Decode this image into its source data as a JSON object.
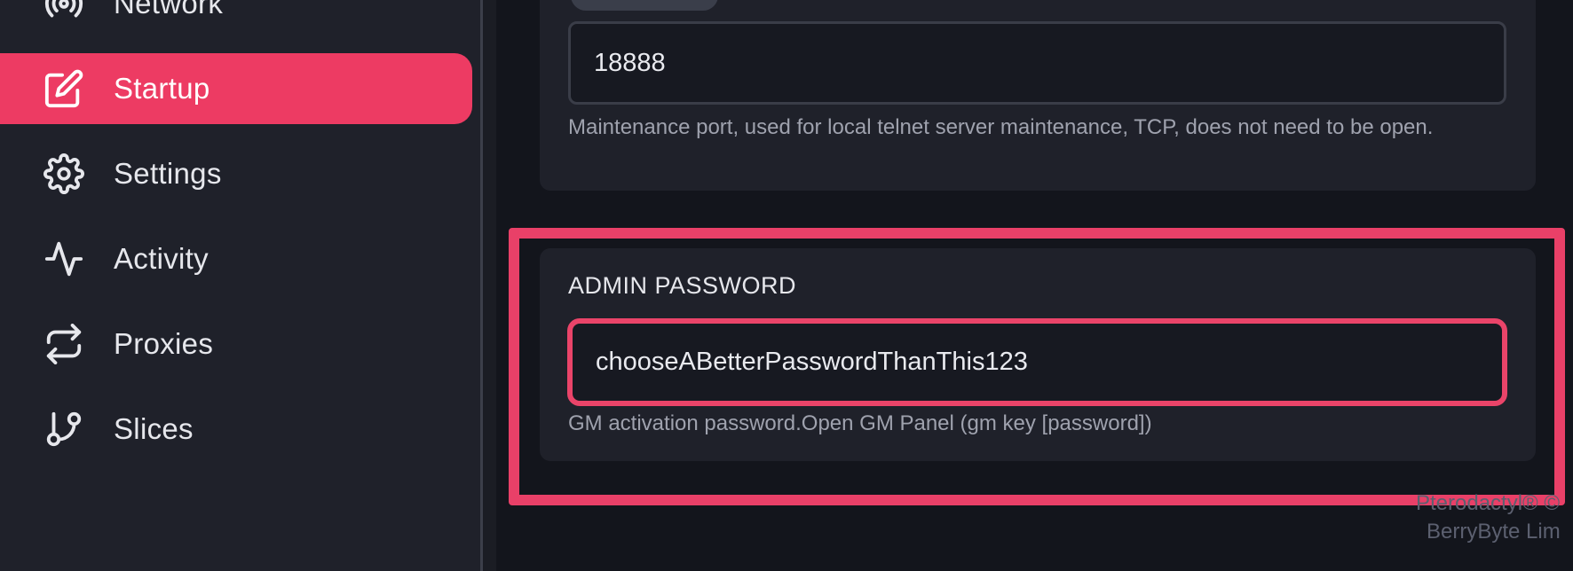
{
  "sidebar": {
    "items": [
      {
        "label": "Network",
        "icon": "broadcast-icon",
        "active": false
      },
      {
        "label": "Startup",
        "icon": "edit-icon",
        "active": true
      },
      {
        "label": "Settings",
        "icon": "gear-icon",
        "active": false
      },
      {
        "label": "Activity",
        "icon": "activity-icon",
        "active": false
      },
      {
        "label": "Proxies",
        "icon": "repeat-icon",
        "active": false
      },
      {
        "label": "Slices",
        "icon": "git-branch-icon",
        "active": false
      }
    ]
  },
  "main": {
    "maintenance_port": {
      "value": "18888",
      "description": "Maintenance port, used for local telnet server maintenance, TCP, does not need to be open."
    },
    "admin_password": {
      "label": "ADMIN PASSWORD",
      "value": "chooseABetterPasswordThanThis123",
      "description": "GM activation password.Open GM Panel (gm key [password])"
    }
  },
  "footer": {
    "line1": "Pterodactyl® ©",
    "line2": "BerryByte Lim"
  },
  "colors": {
    "accent": "#ed3b63",
    "highlight": "#e94068",
    "sidebar_bg": "#1f212a",
    "page_bg": "#13151c"
  }
}
